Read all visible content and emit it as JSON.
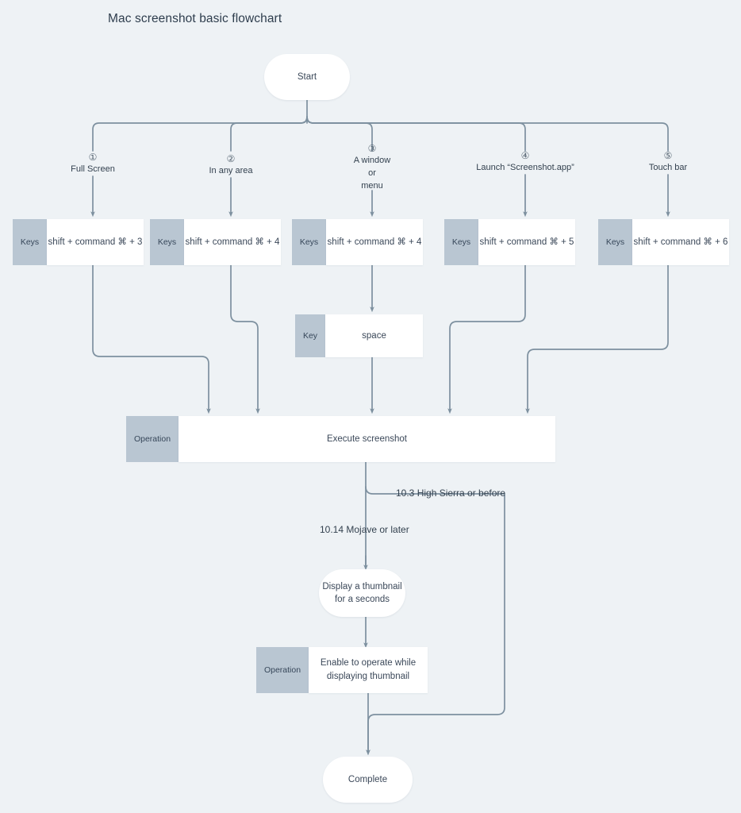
{
  "title": "Mac screenshot basic flowchart",
  "colors": {
    "background": "#eef2f5",
    "wire": "#7d909f",
    "chip": "#b9c6d2",
    "box": "#ffffff",
    "text": "#3b4859"
  },
  "start_node": {
    "label": "Start"
  },
  "branches": [
    {
      "marker": "①",
      "label": "Full Screen"
    },
    {
      "marker": "②",
      "label": "In any area"
    },
    {
      "marker": "③",
      "label": "A window\nor\nmenu",
      "line1": "A window",
      "line2": "or",
      "line3": "menu"
    },
    {
      "marker": "④",
      "label": "Launch “Screenshot.app”"
    },
    {
      "marker": "⑤",
      "label": "Touch bar"
    }
  ],
  "key_boxes": [
    {
      "chip": "Keys",
      "value": "shift + command ⌘ + 3"
    },
    {
      "chip": "Keys",
      "value": "shift + command ⌘ + 4"
    },
    {
      "chip": "Keys",
      "value": "shift + command ⌘ + 4"
    },
    {
      "chip": "Keys",
      "value": "shift + command ⌘ + 5"
    },
    {
      "chip": "Keys",
      "value": "shift + command ⌘ + 6"
    }
  ],
  "space_box": {
    "chip": "Key",
    "value": "space"
  },
  "execute_box": {
    "chip": "Operation",
    "value": "Execute screenshot"
  },
  "version_branches": {
    "old": "10.3 High Sierra or before",
    "new": "10.14 Mojave or later"
  },
  "thumbnail_node": {
    "line1": "Display a thumbnail",
    "line2": "for a seconds"
  },
  "enable_box": {
    "chip": "Operation",
    "line1": "Enable to operate while",
    "line2": "displaying thumbnail"
  },
  "complete_node": {
    "label": "Complete"
  }
}
